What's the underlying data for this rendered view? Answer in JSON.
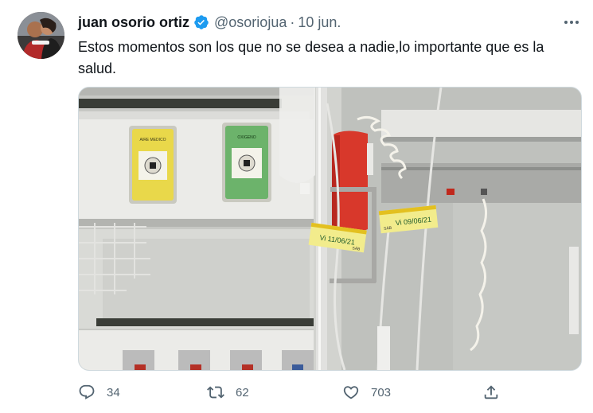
{
  "tweet": {
    "author_name": "juan osorio ortiz",
    "handle": "@osoriojua",
    "separator": "·",
    "date": "10 jun.",
    "text": "Estos momentos son los que no se desea a nadie,lo importante que es la salud.",
    "media": {
      "panel_left_label": "AIRE MEDICO",
      "panel_right_label": "OXIGENO",
      "tag_left_text": "Vi 11/06/21",
      "tag_left_side": "SÁB",
      "tag_right_text": "Vi 09/06/21",
      "tag_right_side": "SÁB"
    },
    "stats": {
      "replies": "34",
      "retweets": "62",
      "likes": "703"
    },
    "icons": {
      "verified": "verified-badge-icon",
      "more": "more-options-icon",
      "reply": "reply-icon",
      "retweet": "retweet-icon",
      "like": "heart-icon",
      "share": "share-icon"
    },
    "colors": {
      "verified": "#1d9bf0",
      "secondary_text": "#536471"
    }
  }
}
